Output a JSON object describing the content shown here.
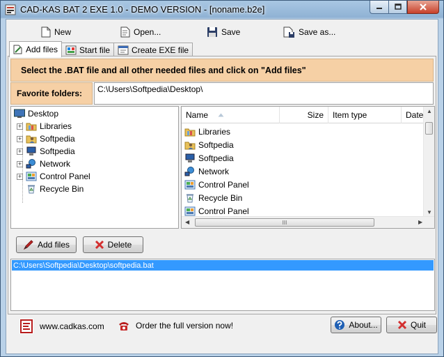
{
  "window": {
    "title": "CAD-KAS BAT 2 EXE 1.0 - DEMO VERSION - [noname.b2e]"
  },
  "toolbar": {
    "new_label": "New",
    "open_label": "Open...",
    "save_label": "Save",
    "save_as_label": "Save as..."
  },
  "tabs": [
    {
      "label": "Add files",
      "active": true
    },
    {
      "label": "Start file",
      "active": false
    },
    {
      "label": "Create EXE file",
      "active": false
    }
  ],
  "add_files_tab": {
    "instruction": "Select the .BAT file and all other needed files and click on \"Add files\"",
    "favorite_label": "Favorite folders:",
    "favorite_value": "C:\\Users\\Softpedia\\Desktop\\"
  },
  "tree": {
    "root": "Desktop",
    "items": [
      {
        "label": "Libraries",
        "icon": "libraries-icon",
        "expandable": true
      },
      {
        "label": "Softpedia",
        "icon": "user-folder-icon",
        "expandable": true
      },
      {
        "label": "Softpedia",
        "icon": "computer-icon",
        "expandable": true
      },
      {
        "label": "Network",
        "icon": "network-icon",
        "expandable": true
      },
      {
        "label": "Control Panel",
        "icon": "control-panel-icon",
        "expandable": true
      },
      {
        "label": "Recycle Bin",
        "icon": "recycle-bin-icon",
        "expandable": false
      }
    ]
  },
  "file_list": {
    "columns": [
      "Name",
      "Size",
      "Item type",
      "Date"
    ],
    "rows": [
      {
        "name": "Libraries",
        "icon": "libraries-icon"
      },
      {
        "name": "Softpedia",
        "icon": "user-folder-icon"
      },
      {
        "name": "Softpedia",
        "icon": "computer-icon"
      },
      {
        "name": "Network",
        "icon": "network-icon"
      },
      {
        "name": "Control Panel",
        "icon": "control-panel-icon"
      },
      {
        "name": "Recycle Bin",
        "icon": "recycle-bin-icon"
      },
      {
        "name": "Control Panel",
        "icon": "control-panel-icon"
      }
    ],
    "hscroll_grip": "III"
  },
  "actions": {
    "add_files_label": "Add files",
    "delete_label": "Delete"
  },
  "added_files": [
    "C:\\Users\\Softpedia\\Desktop\\softpedia.bat"
  ],
  "footer": {
    "website": "www.cadkas.com",
    "order": "Order the full version now!",
    "about_label": "About...",
    "quit_label": "Quit"
  },
  "colors": {
    "banner": "#f6d0a5",
    "selection": "#3399ff"
  }
}
